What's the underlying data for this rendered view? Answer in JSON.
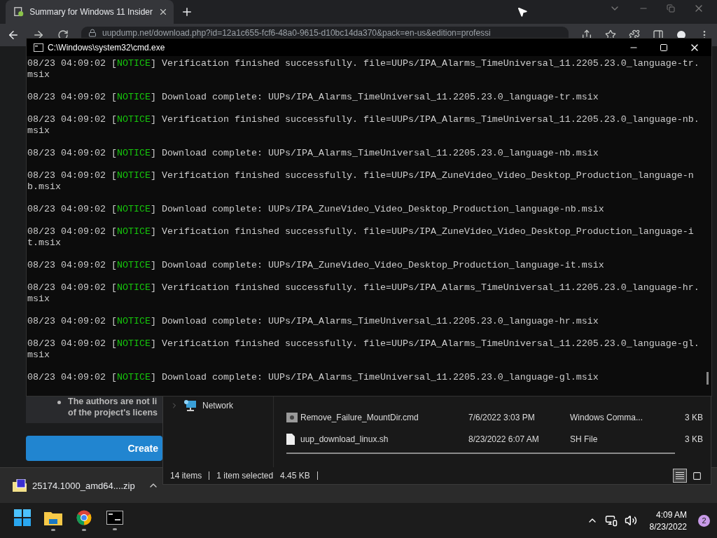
{
  "browser": {
    "tab": {
      "title": "Summary for Windows 11 Insider"
    },
    "address": "uupdump.net/download.php?id=12a1c655-fcf6-48a0-9615-d10bc14da370&pack=en-us&edition=professi",
    "page": {
      "bullet_lines": [
        "The authors are not li",
        "of the project's licens"
      ],
      "button": "Create"
    },
    "download": {
      "file": "25174.1000_amd64....zip"
    }
  },
  "console": {
    "title": "C:\\Windows\\system32\\cmd.exe",
    "lines": [
      {
        "before": "08/23 04:09:02 [",
        "level": "NOTICE",
        "after": "] Verification finished successfully. file=UUPs/IPA_Alarms_TimeUniversal_11.2205.23.0_language-tr.msix"
      },
      {
        "before": "08/23 04:09:02 [",
        "level": "NOTICE",
        "after": "] Download complete: UUPs/IPA_Alarms_TimeUniversal_11.2205.23.0_language-tr.msix"
      },
      {
        "before": "08/23 04:09:02 [",
        "level": "NOTICE",
        "after": "] Verification finished successfully. file=UUPs/IPA_Alarms_TimeUniversal_11.2205.23.0_language-nb.msix"
      },
      {
        "before": "08/23 04:09:02 [",
        "level": "NOTICE",
        "after": "] Download complete: UUPs/IPA_Alarms_TimeUniversal_11.2205.23.0_language-nb.msix"
      },
      {
        "before": "08/23 04:09:02 [",
        "level": "NOTICE",
        "after": "] Verification finished successfully. file=UUPs/IPA_ZuneVideo_Video_Desktop_Production_language-nb.msix"
      },
      {
        "before": "08/23 04:09:02 [",
        "level": "NOTICE",
        "after": "] Download complete: UUPs/IPA_ZuneVideo_Video_Desktop_Production_language-nb.msix"
      },
      {
        "before": "08/23 04:09:02 [",
        "level": "NOTICE",
        "after": "] Verification finished successfully. file=UUPs/IPA_ZuneVideo_Video_Desktop_Production_language-it.msix"
      },
      {
        "before": "08/23 04:09:02 [",
        "level": "NOTICE",
        "after": "] Download complete: UUPs/IPA_ZuneVideo_Video_Desktop_Production_language-it.msix"
      },
      {
        "before": "08/23 04:09:02 [",
        "level": "NOTICE",
        "after": "] Verification finished successfully. file=UUPs/IPA_Alarms_TimeUniversal_11.2205.23.0_language-hr.msix"
      },
      {
        "before": "08/23 04:09:02 [",
        "level": "NOTICE",
        "after": "] Download complete: UUPs/IPA_Alarms_TimeUniversal_11.2205.23.0_language-hr.msix"
      },
      {
        "before": "08/23 04:09:02 [",
        "level": "NOTICE",
        "after": "] Verification finished successfully. file=UUPs/IPA_Alarms_TimeUniversal_11.2205.23.0_language-gl.msix"
      },
      {
        "before": "08/23 04:09:02 [",
        "level": "NOTICE",
        "after": "] Download complete: UUPs/IPA_Alarms_TimeUniversal_11.2205.23.0_language-gl.msix"
      }
    ]
  },
  "explorer": {
    "sidebar": [
      {
        "label": "Network"
      }
    ],
    "files": [
      {
        "kind": "cmd",
        "name": "Remove_Failure_MountDir.cmd",
        "date": "7/6/2022 3:03 PM",
        "type": "Windows Comma...",
        "size": "3 KB"
      },
      {
        "kind": "sh",
        "name": "uup_download_linux.sh",
        "date": "8/23/2022 6:07 AM",
        "type": "SH File",
        "size": "3 KB"
      }
    ],
    "status": {
      "count": "14 items",
      "selection": "1 item selected",
      "size": "4.45 KB"
    }
  },
  "taskbar": {
    "apps": [
      {
        "kind": "start",
        "running": false
      },
      {
        "kind": "explorer",
        "running": true
      },
      {
        "kind": "chrome",
        "running": true
      },
      {
        "kind": "terminal",
        "running": true
      }
    ],
    "time": "4:09 AM",
    "date": "8/23/2022",
    "notifications": "2"
  }
}
